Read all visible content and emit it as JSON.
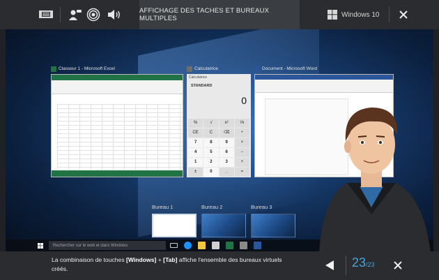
{
  "topbar": {
    "title": "AFFICHAGE DES TACHES ET BUREAUX MULTIPLES",
    "os_label": "Windows 10",
    "icons": [
      "presentation-icon",
      "user-speech-icon",
      "radio-waves-icon",
      "speaker-icon",
      "windows-logo-icon",
      "close-icon"
    ]
  },
  "windows": {
    "excel_title": "Classeur 1 - Microsoft Excel",
    "calc_title": "Calculatrice",
    "word_title": "Document - Microsoft Word",
    "calc_header": "Calculatrice",
    "calc_mode": "STANDARD",
    "calc_display": "0",
    "calc_keys": [
      "%",
      "√",
      "x²",
      "¹⁄x",
      "CE",
      "C",
      "⌫",
      "÷",
      "7",
      "8",
      "9",
      "×",
      "4",
      "5",
      "6",
      "−",
      "1",
      "2",
      "3",
      "+",
      "±",
      "0",
      ",",
      "="
    ]
  },
  "bureaux": [
    {
      "label": "Bureau 1"
    },
    {
      "label": "Bureau 2"
    },
    {
      "label": "Bureau 3"
    }
  ],
  "taskbar": {
    "search_placeholder": "Rechercher sur le web et dans Windows"
  },
  "footer": {
    "caption_part1": "La combinaison de touches ",
    "key1": "[Windows]",
    "plus": " + ",
    "key2": "[Tab]",
    "caption_part2": " affiche l'ensemble des bureaux virtuels créés.",
    "current_page": "23",
    "total_pages": "/23"
  },
  "colors": {
    "bar_bg": "#2a2c2f",
    "accent": "#4aa3d9",
    "excel_green": "#217346",
    "word_blue": "#2b579a"
  }
}
